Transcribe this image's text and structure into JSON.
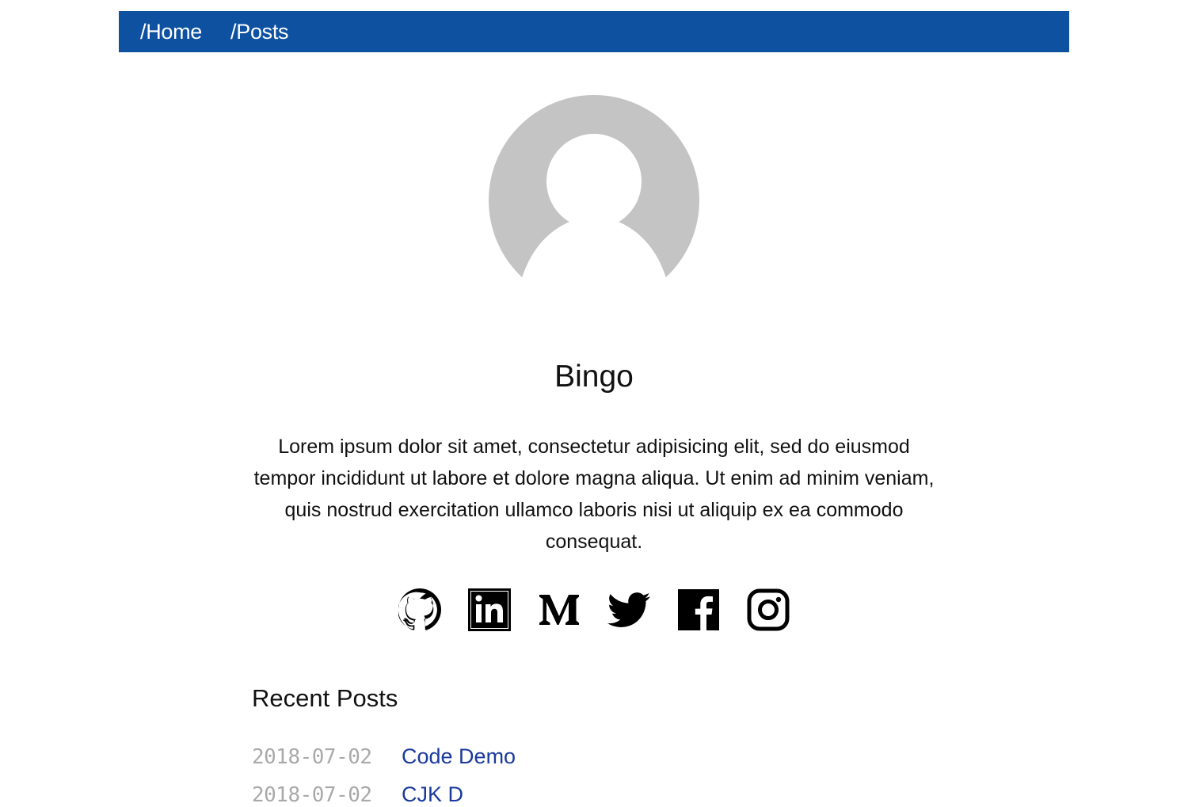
{
  "nav": {
    "home_label": "/Home",
    "posts_label": "/Posts",
    "background": "#0d51a0"
  },
  "profile": {
    "avatar_icon": "default-user-avatar-icon",
    "name": "Bingo",
    "bio": "Lorem ipsum dolor sit amet, consectetur adipisicing elit, sed do eiusmod tempor incididunt ut labore et dolore magna aliqua. Ut enim ad minim veniam, quis nostrud exercitation ullamco laboris nisi ut aliquip ex ea commodo consequat."
  },
  "socials": [
    {
      "icon": "github-icon"
    },
    {
      "icon": "linkedin-icon"
    },
    {
      "icon": "medium-icon"
    },
    {
      "icon": "twitter-icon"
    },
    {
      "icon": "facebook-icon"
    },
    {
      "icon": "instagram-icon"
    }
  ],
  "recent_posts": {
    "title": "Recent Posts",
    "items": [
      {
        "date": "2018-07-02",
        "title": "Code Demo"
      },
      {
        "date": "2018-07-02",
        "title": "CJK D"
      }
    ]
  },
  "colors": {
    "link": "#1a3a9c",
    "date": "#a9a9a9",
    "avatar": "#c4c4c4"
  }
}
